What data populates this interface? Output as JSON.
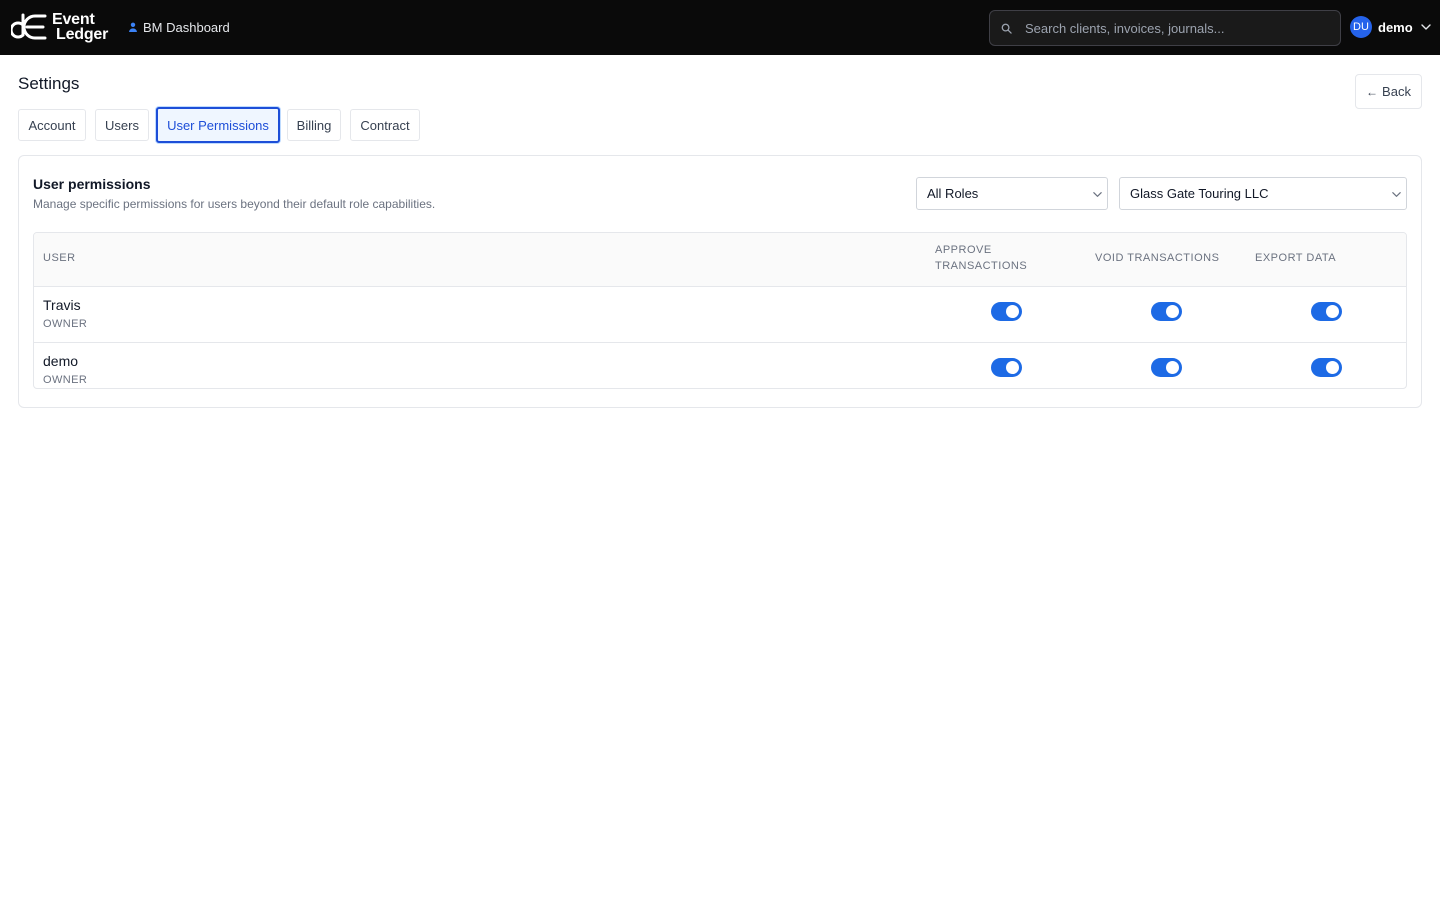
{
  "brand": {
    "line1": "Event",
    "line2": "Ledger"
  },
  "nav": {
    "dashboard_label": "BM Dashboard"
  },
  "search": {
    "placeholder": "Search clients, invoices, journals..."
  },
  "user": {
    "initials": "DU",
    "name": "demo"
  },
  "page": {
    "title": "Settings",
    "back_label": "Back"
  },
  "tabs": [
    {
      "label": "Account",
      "active": false
    },
    {
      "label": "Users",
      "active": false
    },
    {
      "label": "User Permissions",
      "active": true
    },
    {
      "label": "Billing",
      "active": false
    },
    {
      "label": "Contract",
      "active": false
    }
  ],
  "permissions": {
    "title": "User permissions",
    "subtitle": "Manage specific permissions for users beyond their default role capabilities.",
    "role_filter": "All Roles",
    "company_filter": "Glass Gate Touring LLC",
    "columns": {
      "user": "USER",
      "approve_line1": "APPROVE",
      "approve_line2": "TRANSACTIONS",
      "void": "VOID TRANSACTIONS",
      "export": "EXPORT DATA"
    },
    "rows": [
      {
        "name": "Travis",
        "role": "OWNER",
        "approve_transactions": true,
        "void_transactions": true,
        "export_data": true
      },
      {
        "name": "demo",
        "role": "OWNER",
        "approve_transactions": true,
        "void_transactions": true,
        "export_data": true
      }
    ]
  },
  "colors": {
    "accent": "#1d6ae5",
    "topbar": "#0a0a0a",
    "active_tab": "#1d4ed8"
  }
}
